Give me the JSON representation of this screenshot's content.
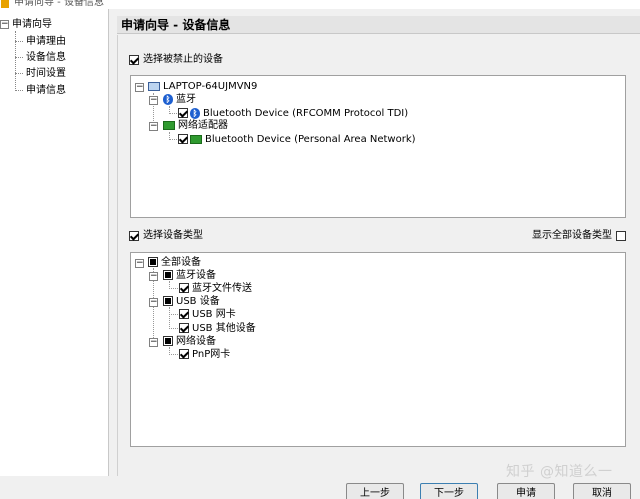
{
  "window": {
    "title": "申请向导 - 设备信息"
  },
  "nav": {
    "root": "申请向导",
    "items": [
      "申请理由",
      "设备信息",
      "时间设置",
      "申请信息"
    ]
  },
  "header": {
    "title": "申请向导 - 设备信息"
  },
  "devices_section": {
    "checkbox_label": "选择被禁止的设备",
    "tree": {
      "computer": "LAPTOP-64UJMVN9",
      "bt_group": "蓝牙",
      "bt_device": "Bluetooth Device (RFCOMM Protocol TDI)",
      "net_group": "网络适配器",
      "net_device": "Bluetooth Device (Personal Area Network)"
    }
  },
  "types_section": {
    "checkbox_label": "选择设备类型",
    "show_all_label": "显示全部设备类型",
    "tree": {
      "all": "全部设备",
      "bt_group": "蓝牙设备",
      "bt_file": "蓝牙文件传送",
      "usb_group": "USB 设备",
      "usb_nic": "USB 网卡",
      "usb_other": "USB 其他设备",
      "net_group": "网络设备",
      "pnp_nic": "PnP网卡"
    }
  },
  "buttons": {
    "prev": "上一步",
    "next": "下一步",
    "apply": "申请",
    "cancel": "取消"
  },
  "watermark": "知乎 @知道么一",
  "colors": {
    "accent": "#3c7fb1",
    "bluetooth": "#1d5fd0",
    "network": "#2f9a2f"
  }
}
